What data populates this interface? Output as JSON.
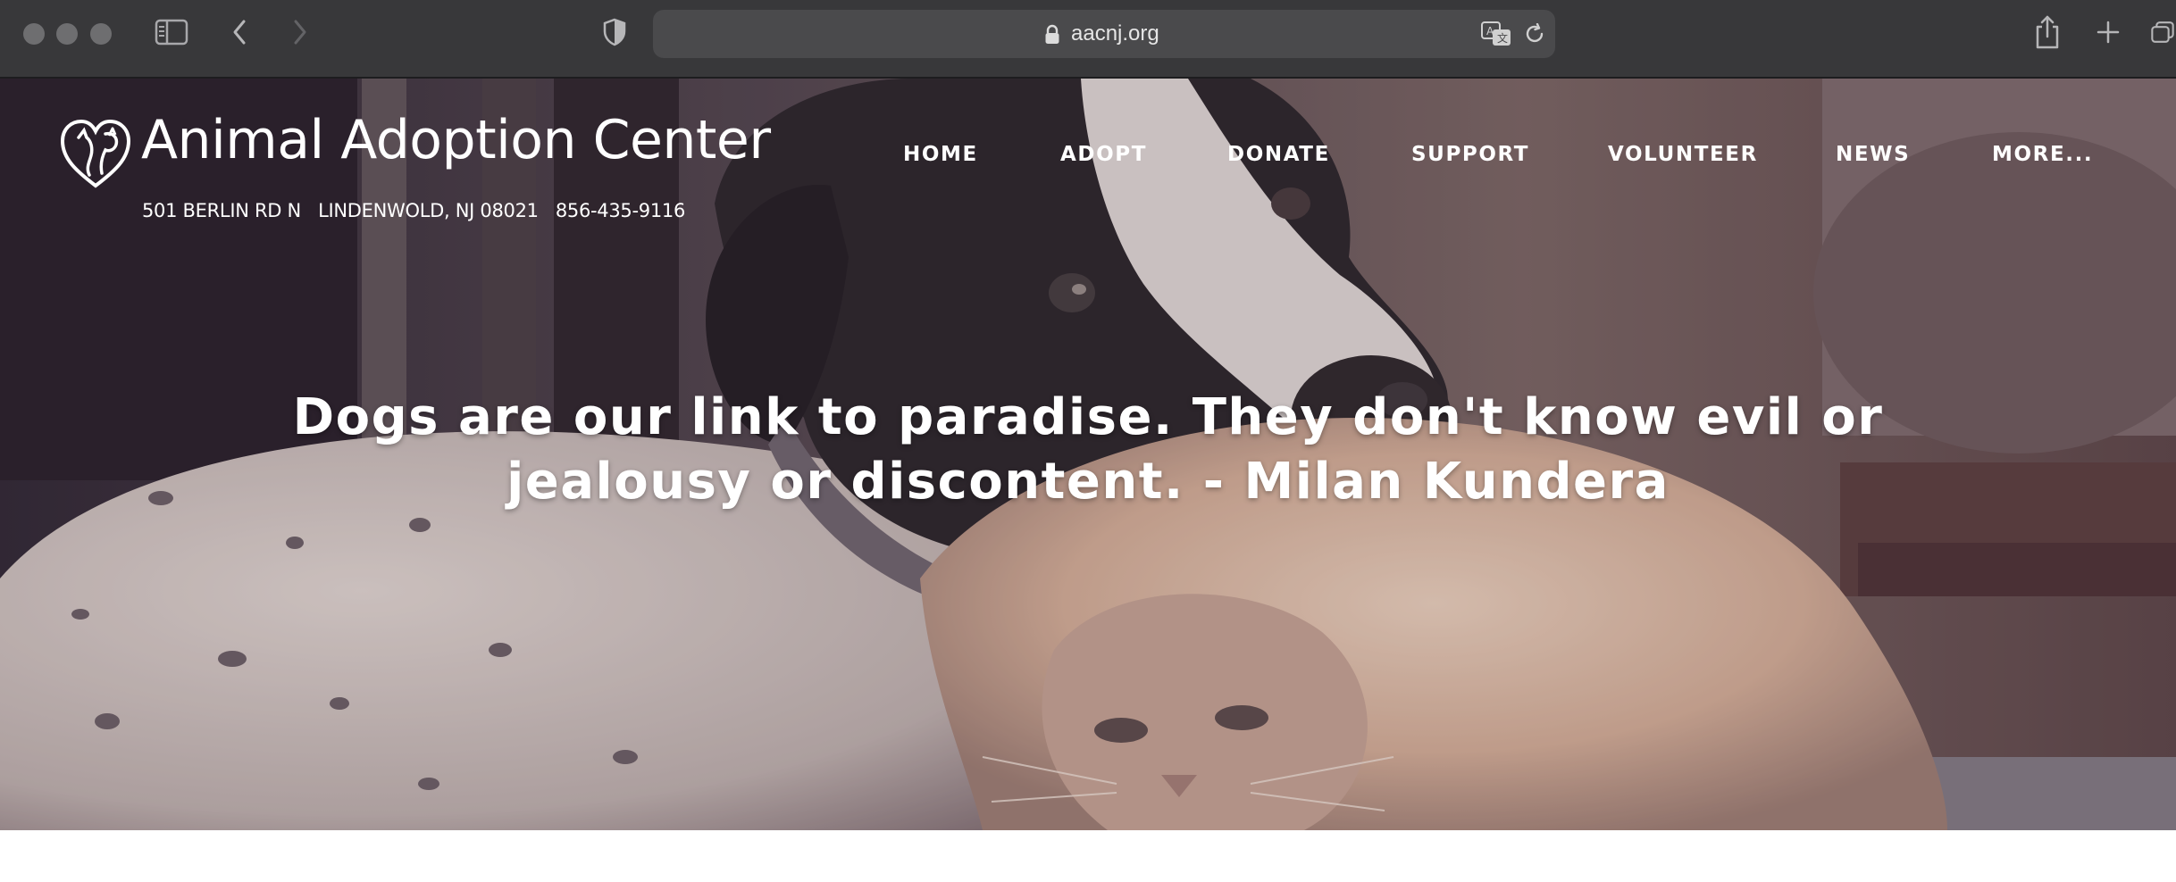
{
  "browser": {
    "url": "aacnj.org",
    "chrome_color": "#38383a",
    "icons": [
      "sidebar-icon",
      "chevron-left-icon",
      "chevron-right-icon",
      "shield-icon",
      "lock-icon",
      "translate-icon",
      "reload-icon",
      "share-icon",
      "plus-icon",
      "tabs-icon"
    ]
  },
  "site": {
    "logo": {
      "title": "Animal Adoption Center",
      "address": "501 BERLIN RD N   LINDENWOLD, NJ 08021   856-435-9116"
    },
    "nav": [
      {
        "label": "HOME"
      },
      {
        "label": "ADOPT"
      },
      {
        "label": "DONATE"
      },
      {
        "label": "SUPPORT"
      },
      {
        "label": "VOLUNTEER"
      },
      {
        "label": "NEWS"
      },
      {
        "label": "MORE..."
      }
    ],
    "hero": {
      "quote": "Dogs are our link to paradise. They don't know evil or jealousy or discontent. - Milan Kundera",
      "image": "dog-and-cat-photo"
    }
  }
}
